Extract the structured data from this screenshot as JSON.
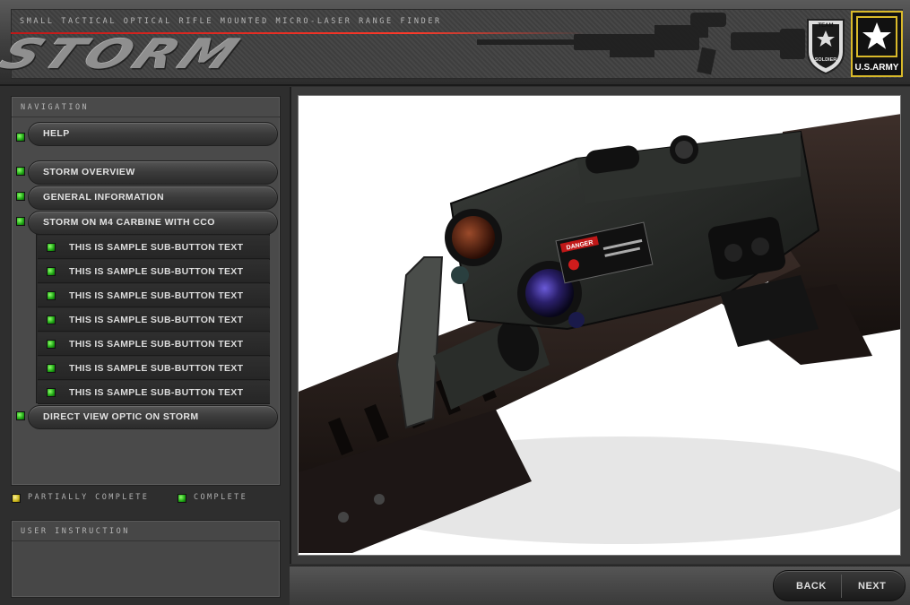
{
  "header": {
    "subtitle": "Small Tactical Optical Rifle Mounted Micro-Laser Range Finder",
    "logo_text": "STORM",
    "team_badge_text": "TEAM SOLDIER",
    "army_badge_text": "U.S.ARMY"
  },
  "navigation": {
    "title": "Navigation",
    "items": [
      {
        "label": "Help",
        "status": "complete"
      },
      {
        "label": "Storm Overview",
        "status": "complete"
      },
      {
        "label": "General Information",
        "status": "complete"
      },
      {
        "label": "Storm on M4 Carbine with CCO",
        "status": "complete"
      }
    ],
    "sub_items": [
      {
        "label": "This is sample sub-button text"
      },
      {
        "label": "This is sample sub-button text"
      },
      {
        "label": "This is sample sub-button text"
      },
      {
        "label": "This is sample sub-button text"
      },
      {
        "label": "This is sample sub-button text"
      },
      {
        "label": "This is sample sub-button text"
      },
      {
        "label": "This is sample sub-button text"
      }
    ],
    "last_item": {
      "label": "Direct View Optic on Storm",
      "status": "complete"
    }
  },
  "legend": {
    "partial": "Partially Complete",
    "complete": "Complete"
  },
  "instruction": {
    "title": "User Instruction",
    "text": ""
  },
  "device_label": {
    "danger": "DANGER"
  },
  "pager": {
    "back": "BACK",
    "next": "NEXT"
  },
  "colors": {
    "led_complete": "#1fa514",
    "led_partial": "#c9b51b",
    "accent_red": "#d01c1c",
    "army_gold": "#d9b92a"
  }
}
